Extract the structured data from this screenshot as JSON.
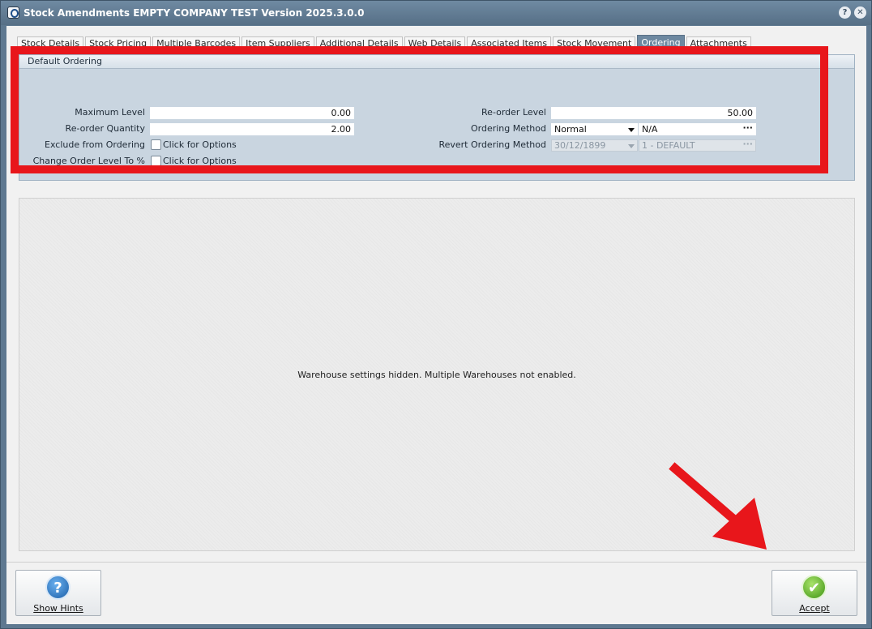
{
  "window": {
    "title": "Stock Amendments EMPTY COMPANY TEST Version 2025.3.0.0",
    "help_glyph": "?",
    "close_glyph": "✕"
  },
  "tabs": [
    {
      "label": "Stock Details"
    },
    {
      "label": "Stock Pricing"
    },
    {
      "label": "Multiple Barcodes"
    },
    {
      "label": "Item Suppliers"
    },
    {
      "label": "Additional Details"
    },
    {
      "label": "Web Details"
    },
    {
      "label": "Associated Items"
    },
    {
      "label": "Stock Movement"
    },
    {
      "label": "Ordering",
      "active": true
    },
    {
      "label": "Attachments"
    }
  ],
  "default_ordering": {
    "header": "Default Ordering",
    "maximum_level": {
      "label": "Maximum Level",
      "value": "0.00"
    },
    "reorder_quantity": {
      "label": "Re-order Quantity",
      "value": "2.00"
    },
    "exclude_from_ordering": {
      "label": "Exclude from Ordering",
      "option": "Click for Options",
      "checked": false
    },
    "change_order_level": {
      "label": "Change Order Level To %",
      "option": "Click for Options",
      "checked": false
    },
    "reorder_level": {
      "label": "Re-order Level",
      "value": "50.00"
    },
    "ordering_method": {
      "label": "Ordering Method",
      "value": "Normal",
      "extra": "N/A"
    },
    "revert_ordering_method": {
      "label": "Revert Ordering Method",
      "date": "30/12/1899",
      "value": "1 - DEFAULT"
    }
  },
  "warehouse": {
    "message": "Warehouse settings hidden. Multiple Warehouses not enabled."
  },
  "buttons": {
    "show_hints": "Show Hints",
    "show_hints_icon": "question-icon",
    "accept": "Accept",
    "accept_icon": "check-icon"
  },
  "icon_glyphs": {
    "question": "?",
    "check": "✔",
    "ellipsis": "···"
  },
  "colors": {
    "annotation_red": "#e8161b",
    "active_tab": "#6d88a0",
    "panel": "#c9d5e0"
  }
}
